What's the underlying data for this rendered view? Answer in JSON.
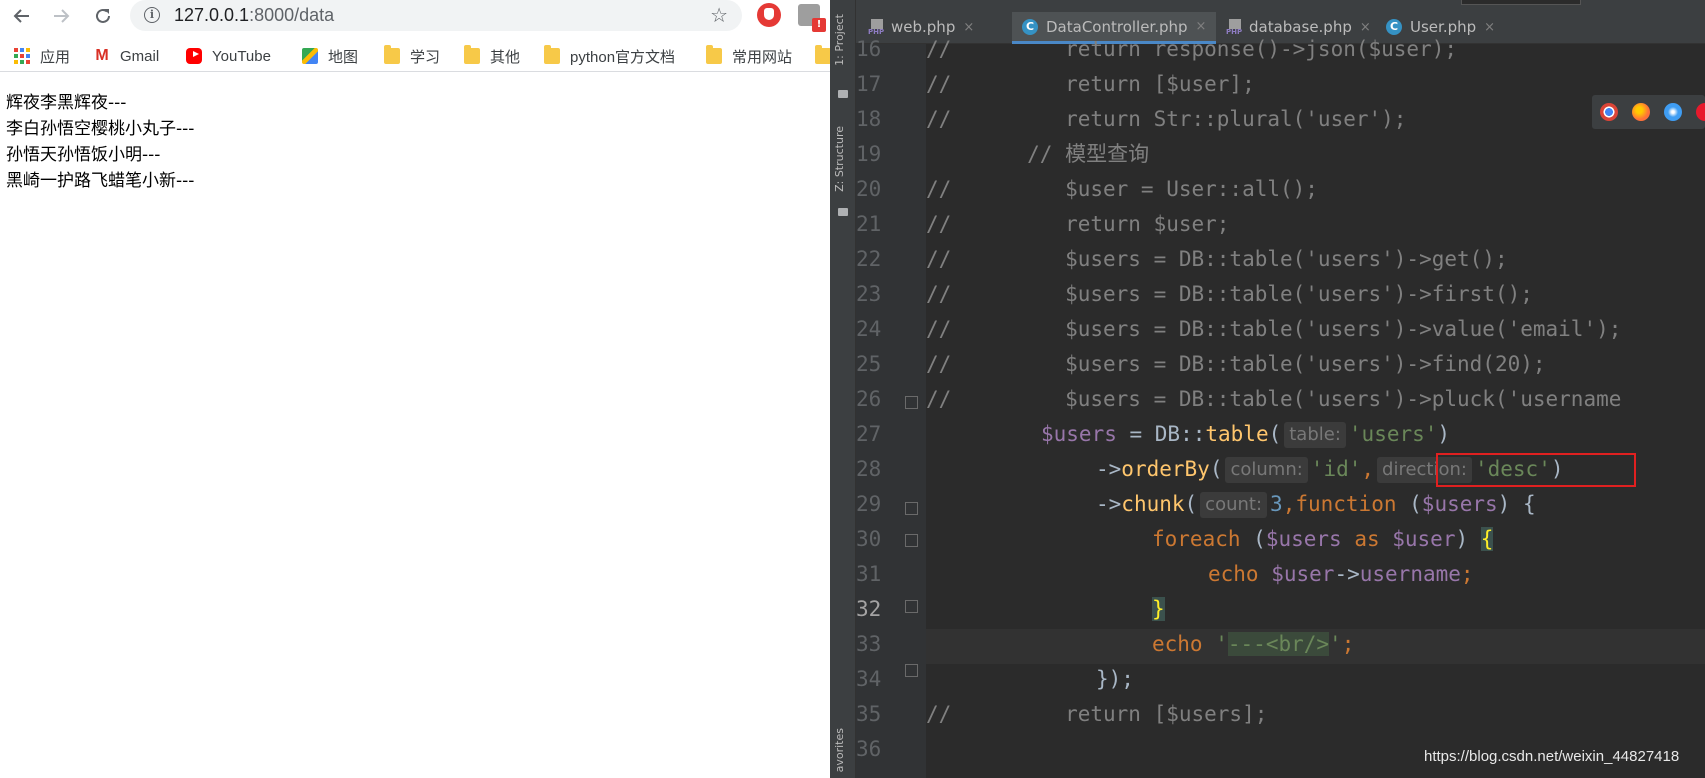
{
  "browser": {
    "url_host": "127.0.0.1",
    "url_rest": ":8000/data",
    "bookmarks": [
      {
        "label": "应用",
        "icon": "apps-grid-icon"
      },
      {
        "label": "Gmail",
        "icon": "gmail-icon"
      },
      {
        "label": "YouTube",
        "icon": "youtube-icon"
      },
      {
        "label": "地图",
        "icon": "maps-icon"
      },
      {
        "label": "学习",
        "icon": "folder-icon"
      },
      {
        "label": "其他",
        "icon": "folder-icon"
      },
      {
        "label": "python官方文档",
        "icon": "folder-icon"
      },
      {
        "label": "常用网站",
        "icon": "folder-icon"
      }
    ],
    "page_lines": [
      "辉夜李黑辉夜---",
      "李白孙悟空樱桃小丸子---",
      "孙悟天孙悟饭小明---",
      "黑崎一护路飞蜡笔小新---"
    ],
    "ext_badge": "!"
  },
  "ide": {
    "sidebar": {
      "project_label": "1: Project",
      "structure_label": "Z: Structure",
      "favorites_label": "avorites"
    },
    "tabs": [
      {
        "label": "web.php",
        "icon": "php-file-icon",
        "active": false
      },
      {
        "label": "DataController.php",
        "icon": "class-file-icon",
        "active": true
      },
      {
        "label": "database.php",
        "icon": "php-file-icon",
        "active": false
      },
      {
        "label": "User.php",
        "icon": "class-file-icon",
        "active": false
      }
    ],
    "tab_close": "×",
    "tab_php_badge": "PHP",
    "tab_class_badge": "C",
    "lines": [
      {
        "n": "16",
        "text": "//         return response()->json($user);"
      },
      {
        "n": "17",
        "text": "//         return [$user];"
      },
      {
        "n": "18",
        "text": "//         return Str::plural('user');"
      },
      {
        "n": "19",
        "text": "        // 模型查询"
      },
      {
        "n": "20",
        "text": "//         $user = User::all();"
      },
      {
        "n": "21",
        "text": "//         return $user;"
      },
      {
        "n": "22",
        "text": "//         $users = DB::table('users')->get();"
      },
      {
        "n": "23",
        "text": "//         $users = DB::table('users')->first();"
      },
      {
        "n": "24",
        "text": "//         $users = DB::table('users')->value('email');"
      },
      {
        "n": "25",
        "text": "//         $users = DB::table('users')->find(20);"
      },
      {
        "n": "26",
        "text": "//         $users = DB::table('users')->pluck('username"
      },
      {
        "n": "27",
        "text": ""
      },
      {
        "n": "28",
        "text": ""
      },
      {
        "n": "29",
        "text": ""
      },
      {
        "n": "30",
        "text": ""
      },
      {
        "n": "31",
        "text": ""
      },
      {
        "n": "32",
        "text": ""
      },
      {
        "n": "33",
        "text": ""
      },
      {
        "n": "34",
        "text": ""
      },
      {
        "n": "35",
        "text": "//         return [$users];"
      },
      {
        "n": "36",
        "text": ""
      }
    ],
    "code": {
      "l27_var": "$users",
      "l27_eq": " = DB::",
      "l27_fn": "table",
      "l27_open": "(",
      "l27_hint": "table:",
      "l27_arg": "'users'",
      "l27_close": ")",
      "l28_arrow": "->",
      "l28_fn": "orderBy",
      "l28_open": "(",
      "l28_hint1": "column:",
      "l28_arg1": "'id'",
      "l28_comma": ",",
      "l28_hint2": "direction:",
      "l28_arg2": "'desc'",
      "l28_close": ")",
      "l29_arrow": "->",
      "l29_fn": "chunk",
      "l29_open": "(",
      "l29_hint": "count:",
      "l29_num": "3",
      "l29_comma": ",",
      "l29_kw": "function",
      "l29_sp": " (",
      "l29_var": "$users",
      "l29_rest": ") {",
      "l30_kw": "foreach",
      "l30_open": " (",
      "l30_var1": "$users",
      "l30_as": " as ",
      "l30_var2": "$user",
      "l30_close": ") ",
      "l30_brace": "{",
      "l31_kw": "echo",
      "l31_sp": " ",
      "l31_var": "$user",
      "l31_arrow": "->",
      "l31_prop": "username",
      "l31_semi": ";",
      "l32_brace": "}",
      "l33_kw": "echo",
      "l33_sp": " ",
      "l33_q1": "'",
      "l33_str": "---<br/>",
      "l33_q2": "'",
      "l33_semi": ";",
      "l34_close": "});"
    },
    "current_line": "32"
  },
  "watermark": "https://blog.csdn.net/weixin_44827418",
  "colors": {
    "editor_bg": "#2b2b2b",
    "comment": "#808080",
    "variable": "#9876aa",
    "keyword": "#cc7832",
    "string": "#6a8759",
    "function": "#ffc66d",
    "number": "#6897bb",
    "highlight_box": "#e02020"
  }
}
